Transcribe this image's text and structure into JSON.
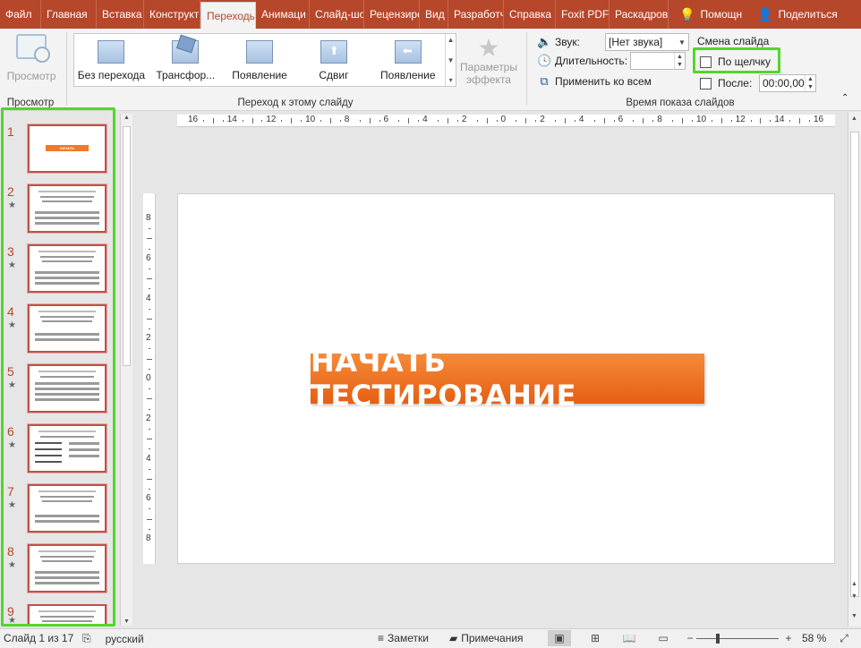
{
  "tabs": [
    {
      "label": "Файл",
      "active": false
    },
    {
      "label": "Главная",
      "active": false
    },
    {
      "label": "Вставка",
      "active": false
    },
    {
      "label": "Конструкт",
      "active": false
    },
    {
      "label": "Переходы",
      "active": true
    },
    {
      "label": "Анимаци",
      "active": false
    },
    {
      "label": "Слайд-шо",
      "active": false
    },
    {
      "label": "Рецензиро",
      "active": false
    },
    {
      "label": "Вид",
      "active": false
    },
    {
      "label": "Разработч",
      "active": false
    },
    {
      "label": "Справка",
      "active": false
    },
    {
      "label": "Foxit PDF",
      "active": false
    },
    {
      "label": "Раскадров",
      "active": false
    }
  ],
  "tell_me": {
    "icon": "lightbulb-icon",
    "label": "Помощн"
  },
  "share": {
    "icon": "person-icon",
    "label": "Поделиться"
  },
  "ribbon": {
    "preview": {
      "button_label": "Просмотр",
      "group_label": "Просмотр"
    },
    "transitions": {
      "gallery": [
        {
          "label": "Без перехода"
        },
        {
          "label": "Трансфор..."
        },
        {
          "label": "Появление"
        },
        {
          "label": "Сдвиг"
        },
        {
          "label": "Появление"
        }
      ],
      "effect_options_line1": "Параметры",
      "effect_options_line2": "эффекта",
      "group_label": "Переход к этому слайду"
    },
    "timing": {
      "sound_label": "Звук:",
      "sound_value": "[Нет звука]",
      "duration_label": "Длительность:",
      "duration_value": "",
      "apply_all_label": "Применить ко всем",
      "advance_title": "Смена слайда",
      "on_click_label": "По щелчку",
      "on_click_checked": false,
      "after_label": "После:",
      "after_checked": false,
      "after_value": "00:00,00",
      "group_label": "Время показа слайдов"
    }
  },
  "slides": [
    {
      "num": "1",
      "kind": "start",
      "has_star": false,
      "title": "НАЧАТЬ ТЕСТИРОВАНИЕ"
    },
    {
      "num": "2",
      "kind": "question",
      "has_star": true
    },
    {
      "num": "3",
      "kind": "question",
      "has_star": true
    },
    {
      "num": "4",
      "kind": "question",
      "has_star": true
    },
    {
      "num": "5",
      "kind": "question",
      "has_star": true
    },
    {
      "num": "6",
      "kind": "question",
      "has_star": true
    },
    {
      "num": "7",
      "kind": "question",
      "has_star": true
    },
    {
      "num": "8",
      "kind": "question",
      "has_star": true
    },
    {
      "num": "9",
      "kind": "question",
      "has_star": true
    }
  ],
  "hruler_labels": [
    "16",
    "14",
    "12",
    "10",
    "8",
    "6",
    "4",
    "2",
    "0",
    "2",
    "4",
    "6",
    "8",
    "10",
    "12",
    "14",
    "16"
  ],
  "vruler_labels": [
    "8",
    "6",
    "4",
    "2",
    "0",
    "2",
    "4",
    "6",
    "8"
  ],
  "current_slide": {
    "button_text": "НАЧАТЬ ТЕСТИРОВАНИЕ"
  },
  "status": {
    "slide_indicator": "Слайд 1 из 17",
    "language": "русский",
    "notes_label": "Заметки",
    "comments_label": "Примечания",
    "zoom": "58 %",
    "zoom_level_fraction": 0.24
  },
  "colors": {
    "ribbon_accent": "#b7472a",
    "highlight_green": "#53d62a",
    "start_button": "#ee7322",
    "thumbnail_border": "#c0504d"
  }
}
